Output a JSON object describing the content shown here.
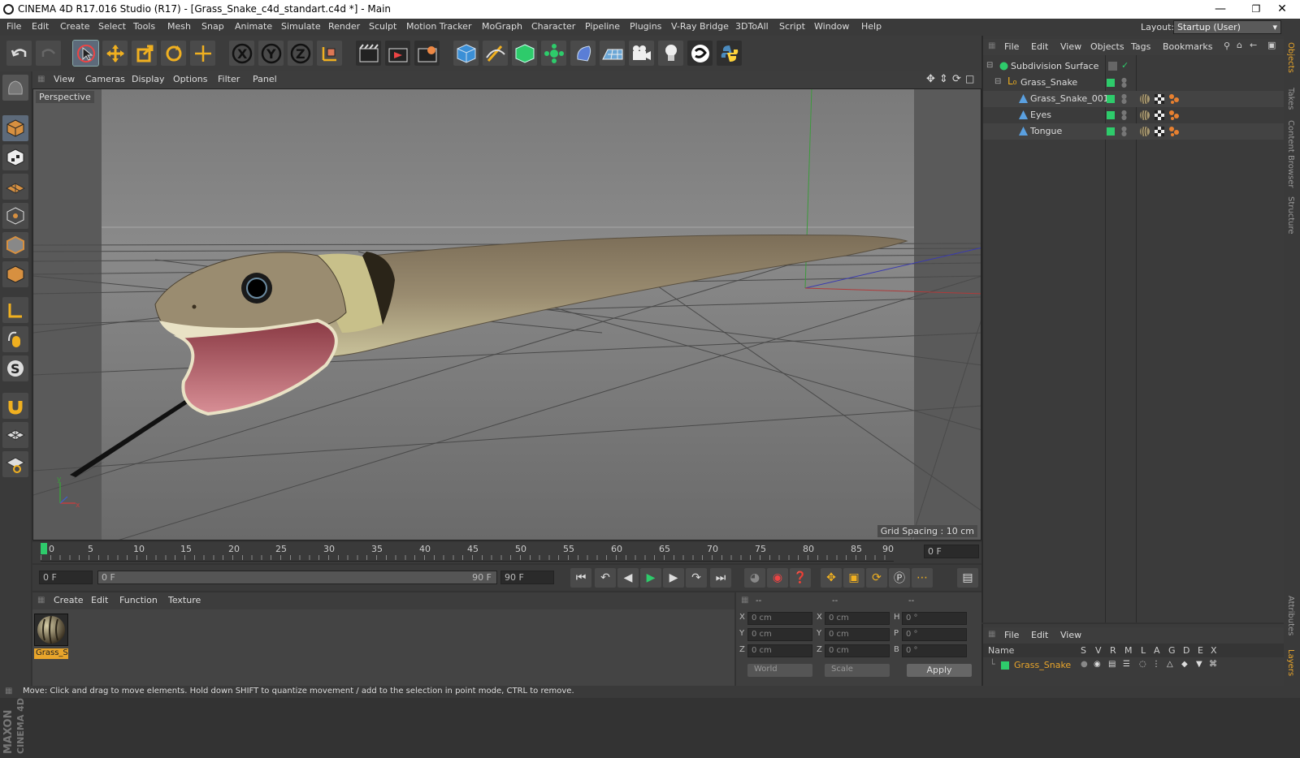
{
  "window": {
    "title": "CINEMA 4D R17.016 Studio (R17) - [Grass_Snake_c4d_standart.c4d *] - Main"
  },
  "menus": [
    "File",
    "Edit",
    "Create",
    "Select",
    "Tools",
    "Mesh",
    "Snap",
    "Animate",
    "Simulate",
    "Render",
    "Sculpt",
    "Motion Tracker",
    "MoGraph",
    "Character",
    "Pipeline",
    "Plugins",
    "V-Ray Bridge",
    "3DToAll",
    "Script",
    "Window",
    "Help"
  ],
  "layout": {
    "label": "Layout:",
    "value": "Startup (User)"
  },
  "viewport": {
    "menus": [
      "View",
      "Cameras",
      "Display",
      "Options",
      "Filter",
      "Panel"
    ],
    "camera_label": "Perspective",
    "grid_spacing": "Grid Spacing : 10 cm"
  },
  "timeline": {
    "ticks": [
      "0",
      "5",
      "10",
      "15",
      "20",
      "25",
      "30",
      "35",
      "40",
      "45",
      "50",
      "55",
      "60",
      "65",
      "70",
      "75",
      "80",
      "85",
      "90"
    ],
    "current_frame": "0 F",
    "start_frame": "0 F",
    "range_start": "0 F",
    "range_end": "90 F",
    "end_frame": "90 F"
  },
  "material_manager": {
    "menus": [
      "Create",
      "Edit",
      "Function",
      "Texture"
    ],
    "material_name": "Grass_Sn"
  },
  "coordinates": {
    "headers": [
      "--",
      "--",
      "--"
    ],
    "rows": [
      {
        "a": "X",
        "av": "0 cm",
        "b": "X",
        "bv": "0 cm",
        "c": "H",
        "cv": "0 °"
      },
      {
        "a": "Y",
        "av": "0 cm",
        "b": "Y",
        "bv": "0 cm",
        "c": "P",
        "cv": "0 °"
      },
      {
        "a": "Z",
        "av": "0 cm",
        "b": "Z",
        "bv": "0 cm",
        "c": "B",
        "cv": "0 °"
      }
    ],
    "mode": "World",
    "size_mode": "Scale",
    "apply": "Apply"
  },
  "objects_panel": {
    "menus": [
      "File",
      "Edit",
      "View",
      "Objects",
      "Tags",
      "Bookmarks"
    ],
    "items": [
      {
        "name": "Subdivision Surface"
      },
      {
        "name": "Grass_Snake"
      },
      {
        "name": "Grass_Snake_001"
      },
      {
        "name": "Eyes"
      },
      {
        "name": "Tongue"
      }
    ]
  },
  "layers_panel": {
    "menus": [
      "File",
      "Edit",
      "View"
    ],
    "columns": [
      "Name",
      "S",
      "V",
      "R",
      "M",
      "L",
      "A",
      "G",
      "D",
      "E",
      "X"
    ],
    "layer": "Grass_Snake"
  },
  "side_tabs": [
    "Objects",
    "Takes",
    "Content Browser",
    "Structure"
  ],
  "side_tabs_bottom": [
    "Attributes",
    "Layers"
  ],
  "logo": {
    "line1": "MAXON",
    "line2": "CINEMA 4D"
  },
  "status": "Move: Click and drag to move elements. Hold down SHIFT to quantize movement / add to the selection in point mode, CTRL to remove.",
  "colors": {
    "accent_green": "#2ecb6b",
    "material_highlight": "#e8a52b"
  }
}
